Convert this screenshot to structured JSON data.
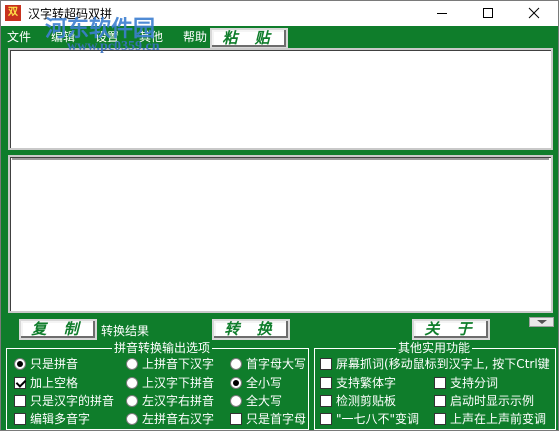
{
  "window": {
    "title": "汉字转超码双拼",
    "icon_glyph": "双",
    "icon_name": "app-icon"
  },
  "menu": {
    "items": [
      "文件",
      "编辑",
      "设置",
      "其他",
      "帮助"
    ]
  },
  "watermark": {
    "line1": "河东软件园",
    "line2": "www.pc0359.cn"
  },
  "toolbar": {
    "paste_label": "粘 贴"
  },
  "input_text": "",
  "output_text": "",
  "actions": {
    "copy_label": "复 制",
    "result_label": "转换结果",
    "convert_label": "转 换",
    "close_label": "关 于"
  },
  "pinyin_group": {
    "title": "拼音转换输出选项",
    "options": [
      {
        "label": "只是拼音",
        "type": "radio",
        "checked": true
      },
      {
        "label": "加上空格",
        "type": "check",
        "checked": true
      },
      {
        "label": "只是汉字的拼音",
        "type": "check",
        "checked": false
      },
      {
        "label": "编辑多音字",
        "type": "check",
        "checked": false
      },
      {
        "label": "上拼音下汉字",
        "type": "radio",
        "checked": false
      },
      {
        "label": "上汉字下拼音",
        "type": "radio",
        "checked": false
      },
      {
        "label": "左汉字右拼音",
        "type": "radio",
        "checked": false
      },
      {
        "label": "左拼音右汉字",
        "type": "radio",
        "checked": false
      },
      {
        "label": "首字母大写",
        "type": "radio",
        "checked": false
      },
      {
        "label": "全小写",
        "type": "radio",
        "checked": true
      },
      {
        "label": "全大写",
        "type": "radio",
        "checked": false
      },
      {
        "label": "只是首字母",
        "type": "check",
        "checked": false
      }
    ]
  },
  "other_group": {
    "title": "其他实用功能",
    "options": [
      {
        "label": "屏幕抓词(移动鼠标到汉字上, 按下Ctrl键",
        "checked": false
      },
      {
        "label": "支持繁体字",
        "checked": false
      },
      {
        "label": "检测剪贴板",
        "checked": false
      },
      {
        "label": "\"一七八不\"变调",
        "checked": false
      },
      {
        "label": "支持分词",
        "checked": false
      },
      {
        "label": "启动时显示示例",
        "checked": false
      },
      {
        "label": "上声在上声前变调",
        "checked": false
      }
    ]
  },
  "colors": {
    "window_bg": "#0f7d2b",
    "button_text": "#0f7d2b",
    "watermark": "#3d7fd1",
    "app_icon": "#c8321e"
  }
}
